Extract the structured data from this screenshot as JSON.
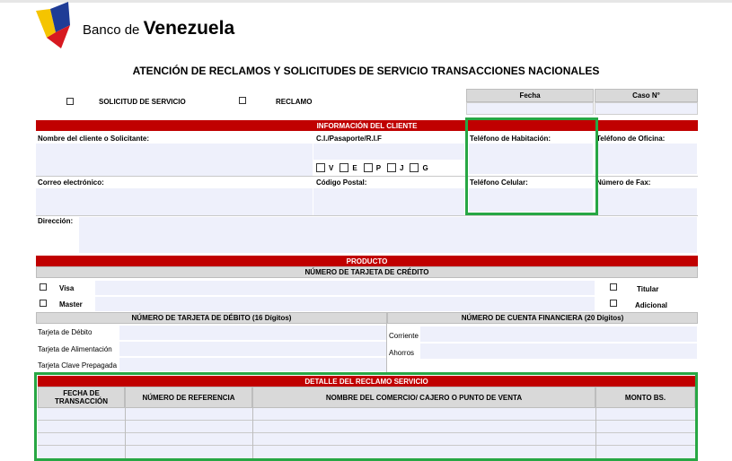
{
  "header": {
    "brand_prefix": "Banco de ",
    "brand_name": "Venezuela",
    "title": "ATENCIÓN DE RECLAMOS Y SOLICITUDES DE SERVICIO TRANSACCIONES NACIONALES"
  },
  "request_type": {
    "solicitud": "SOLICITUD DE SERVICIO",
    "reclamo": "RECLAMO"
  },
  "meta": {
    "fecha": "Fecha",
    "caso": "Caso N°"
  },
  "cliente": {
    "section_title": "INFORMACIÓN DEL CLIENTE",
    "nombre": "Nombre del cliente o Solicitante:",
    "ci": "C.I./Pasaporte/R.I.F",
    "tipos": [
      "V",
      "E",
      "P",
      "J",
      "G"
    ],
    "tel_habitacion": "Teléfono de Habitación:",
    "tel_oficina": "Teléfono de Oficina:",
    "correo": "Correo electrónico:",
    "codigo_postal": "Código Postal:",
    "tel_celular": "Teléfono Celular:",
    "fax": "Número de Fax:",
    "direccion": "Dirección:"
  },
  "producto": {
    "section_title": "PRODUCTO",
    "tarjeta_credito": "NÚMERO DE TARJETA DE CRÉDITO",
    "visa": "Visa",
    "master": "Master",
    "titular": "Titular",
    "adicional": "Adicional",
    "tarjeta_debito_hdr": "NÚMERO DE TARJETA DE DÉBITO (16 Dígitos)",
    "cuenta_hdr": "NÚMERO DE CUENTA FINANCIERA (20 Dígitos)",
    "debito": "Tarjeta de Débito",
    "alimentacion": "Tarjeta de Alimentación",
    "prepagada": "Tarjeta Clave Prepagada",
    "corriente": "Corriente",
    "ahorros": "Ahorros"
  },
  "detalle": {
    "section_title": "DETALLE DEL RECLAMO SERVICIO",
    "col_fecha": "FECHA DE TRANSACCIÓN",
    "col_referencia": "NÚMERO DE REFERENCIA",
    "col_comercio": "NOMBRE DEL COMERCIO/ CAJERO O PUNTO DE VENTA",
    "col_monto": "MONTO BS."
  },
  "colors": {
    "brand_yellow": "#f5c400",
    "brand_blue": "#1f3c96",
    "brand_red": "#d71920",
    "section_red": "#c00000",
    "highlight_green": "#27a744"
  }
}
